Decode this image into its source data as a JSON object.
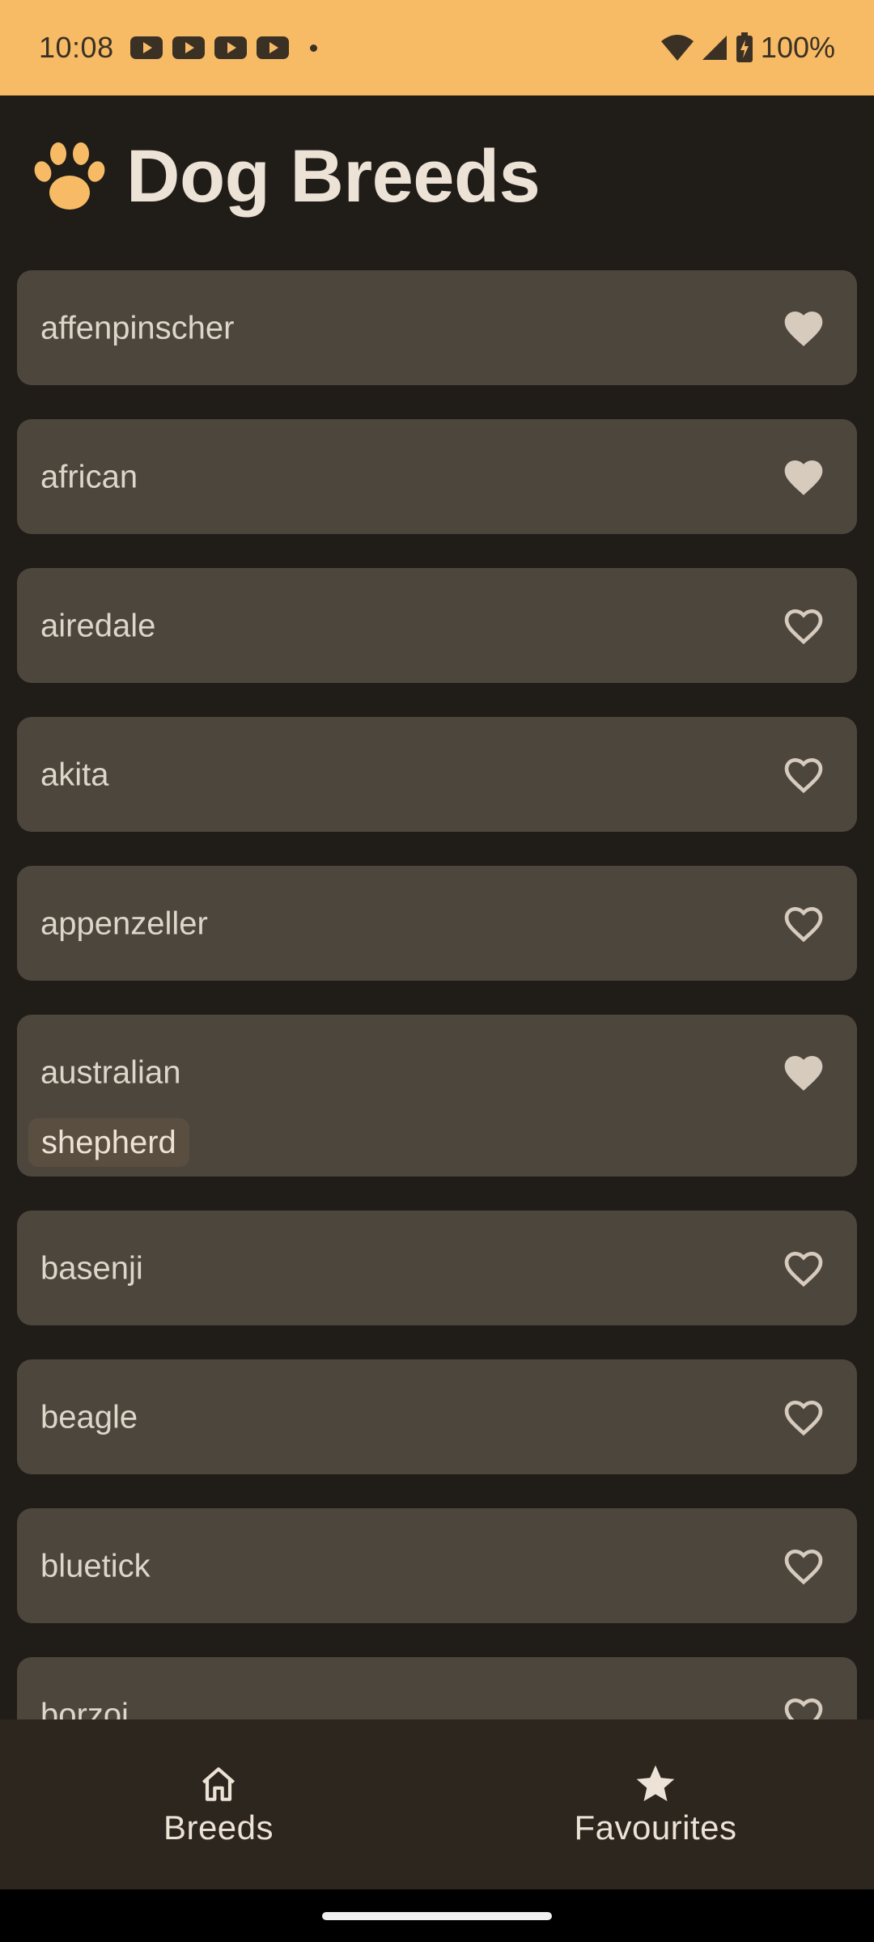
{
  "status_bar": {
    "time": "10:08",
    "notification_icons": [
      "youtube-icon",
      "youtube-icon",
      "youtube-icon",
      "youtube-icon",
      "dot-icon"
    ],
    "battery": "100%",
    "background": "#f7bb66"
  },
  "header": {
    "icon": "paw-icon",
    "title": "Dog Breeds",
    "accent": "#f7bb66"
  },
  "breeds": [
    {
      "name": "affenpinscher",
      "favourite": true
    },
    {
      "name": "african",
      "favourite": true
    },
    {
      "name": "airedale",
      "favourite": false
    },
    {
      "name": "akita",
      "favourite": false
    },
    {
      "name": "appenzeller",
      "favourite": false
    },
    {
      "name": "australian",
      "favourite": true,
      "sub_breeds": [
        "shepherd"
      ]
    },
    {
      "name": "basenji",
      "favourite": false
    },
    {
      "name": "beagle",
      "favourite": false
    },
    {
      "name": "bluetick",
      "favourite": false
    },
    {
      "name": "borzoi",
      "favourite": false
    }
  ],
  "bottom_nav": {
    "items": [
      {
        "label": "Breeds",
        "icon": "home-icon"
      },
      {
        "label": "Favourites",
        "icon": "star-icon"
      }
    ]
  }
}
